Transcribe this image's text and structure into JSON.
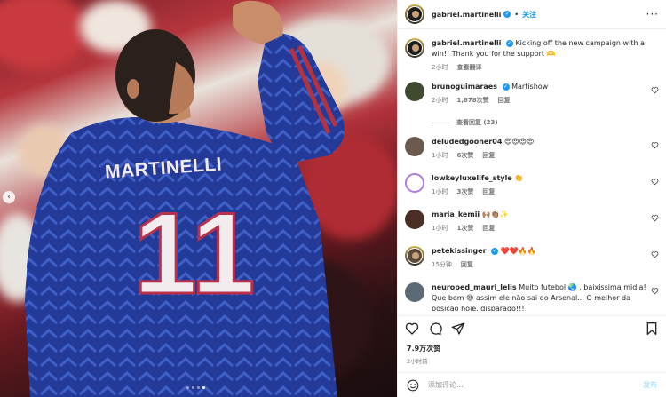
{
  "post": {
    "author": "gabriel.martinelli",
    "follow_label": "关注",
    "more_label": "···",
    "jersey_name": "MARTINELLI",
    "jersey_number": "11",
    "carousel_prev": "‹"
  },
  "caption": {
    "user": "gabriel.martinelli",
    "text": "Kicking off the new campaign with a win!! Thank you for the support 🫶",
    "time": "2小时",
    "translate_label": "查看翻译"
  },
  "comments": [
    {
      "user": "brunoguimaraes",
      "verified": true,
      "text": "Martishow",
      "time": "2小时",
      "likes": "1,878次赞",
      "reply": "回复",
      "view_replies": "查看回复 (23)"
    },
    {
      "user": "deludedgooner04",
      "verified": false,
      "text": "😍😍😍😍",
      "time": "1小时",
      "likes": "6次赞",
      "reply": "回复"
    },
    {
      "user": "lowkeyluxelife_style",
      "verified": false,
      "text": "👏",
      "time": "1小时",
      "likes": "3次赞",
      "reply": "回复"
    },
    {
      "user": "maria_kemii",
      "verified": false,
      "text": "🙌🏽👏🏽✨",
      "time": "1小时",
      "likes": "1次赞",
      "reply": "回复"
    },
    {
      "user": "petekissinger",
      "verified": true,
      "text": "❤️❤️🔥🔥",
      "time": "15分钟",
      "likes": "",
      "reply": "回复"
    },
    {
      "user": "neuroped_mauri_lelis",
      "verified": false,
      "text": "Muito futebol 🌏 , baixissima midia! Que bom 😍 assim ele não sai do Arsenal... O melhor da posição hoje, disparado!!!",
      "time": "",
      "likes": "",
      "reply": ""
    }
  ],
  "stats": {
    "likes": "7.9万次赞",
    "posted": "2小时前"
  },
  "composer": {
    "placeholder": "添加评论...",
    "post_label": "发布"
  },
  "colors": {
    "accent": "#0095f6",
    "verified": "#1d9bf0",
    "jersey": "#253a9a",
    "muted": "#737373"
  }
}
